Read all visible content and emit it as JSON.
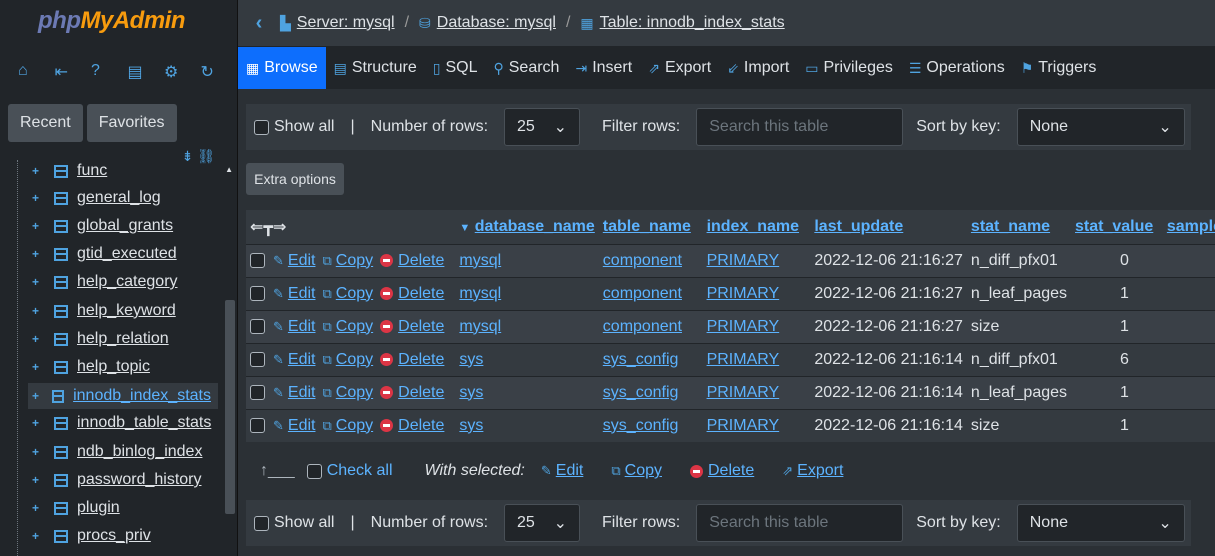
{
  "app": {
    "logo_a": "php",
    "logo_b": "MyAdmin"
  },
  "sidebar": {
    "nav_icons": [
      "home-icon",
      "logout-icon",
      "help-icon",
      "docs-icon",
      "settings-icon",
      "reload-icon"
    ],
    "recent": "Recent",
    "favorites": "Favorites",
    "tables": [
      "func",
      "general_log",
      "global_grants",
      "gtid_executed",
      "help_category",
      "help_keyword",
      "help_relation",
      "help_topic",
      "innodb_index_stats",
      "innodb_table_stats",
      "ndb_binlog_index",
      "password_history",
      "plugin",
      "procs_priv"
    ],
    "active": "innodb_index_stats"
  },
  "breadcrumb": {
    "server": "Server: mysql",
    "database": "Database: mysql",
    "table": "Table: innodb_index_stats"
  },
  "tabs": [
    "Browse",
    "Structure",
    "SQL",
    "Search",
    "Insert",
    "Export",
    "Import",
    "Privileges",
    "Operations",
    "Triggers"
  ],
  "nav": {
    "show_all": "Show all",
    "num_rows_label": "Number of rows:",
    "num_rows": "25",
    "filter_label": "Filter rows:",
    "filter_placeholder": "Search this table",
    "sort_label": "Sort by key:",
    "sort_value": "None"
  },
  "extra_options": "Extra options",
  "table": {
    "columns": [
      "database_name",
      "table_name",
      "index_name",
      "last_update",
      "stat_name",
      "stat_value",
      "sample"
    ],
    "actions": {
      "edit": "Edit",
      "copy": "Copy",
      "delete": "Delete"
    },
    "rows": [
      [
        "mysql",
        "component",
        "PRIMARY",
        "2022-12-06 21:16:27",
        "n_diff_pfx01",
        "0"
      ],
      [
        "mysql",
        "component",
        "PRIMARY",
        "2022-12-06 21:16:27",
        "n_leaf_pages",
        "1"
      ],
      [
        "mysql",
        "component",
        "PRIMARY",
        "2022-12-06 21:16:27",
        "size",
        "1"
      ],
      [
        "sys",
        "sys_config",
        "PRIMARY",
        "2022-12-06 21:16:14",
        "n_diff_pfx01",
        "6"
      ],
      [
        "sys",
        "sys_config",
        "PRIMARY",
        "2022-12-06 21:16:14",
        "n_leaf_pages",
        "1"
      ],
      [
        "sys",
        "sys_config",
        "PRIMARY",
        "2022-12-06 21:16:14",
        "size",
        "1"
      ]
    ]
  },
  "bulk": {
    "check_all": "Check all",
    "with_selected": "With selected:",
    "edit": "Edit",
    "copy": "Copy",
    "delete": "Delete",
    "export": "Export"
  }
}
